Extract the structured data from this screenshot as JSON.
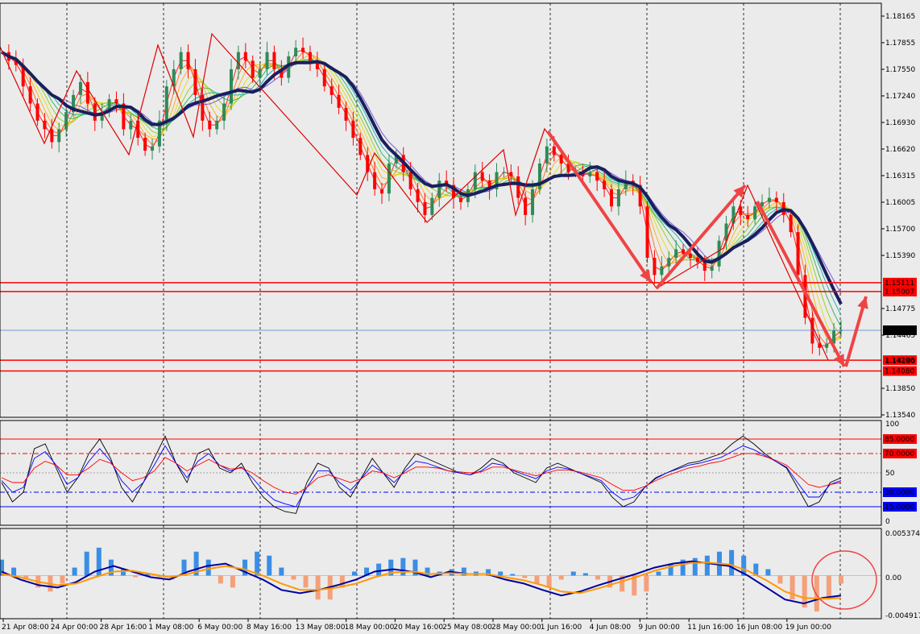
{
  "chart_data": [
    {
      "panel": "price",
      "type": "candlestick",
      "y_ticks": [
        "1.18165",
        "1.17855",
        "1.17550",
        "1.17240",
        "1.16930",
        "1.16620",
        "1.16315",
        "1.16005",
        "1.15700",
        "1.15390"
      ],
      "y_ticks_lower": [
        "1.14775",
        "1.14465",
        "1.13850",
        "1.13540"
      ],
      "ylim": [
        1.1354,
        1.1837
      ],
      "price_levels": [
        {
          "label": "1.15111",
          "value": 1.15111,
          "color": "#ff0000"
        },
        {
          "label": "1.15007",
          "value": 1.15007,
          "color": "#ff0000"
        },
        {
          "label": "1.14206",
          "value": 1.14206,
          "color": "#ff0000"
        },
        {
          "label": "1.14080",
          "value": 1.1408,
          "color": "#ff0000"
        }
      ],
      "current_price": {
        "label": "1.14555",
        "value": 1.14555,
        "color": "#4a7fd0"
      },
      "hidden_label": "1.14180",
      "close_series": [
        1.178,
        1.177,
        1.1765,
        1.174,
        1.172,
        1.17,
        1.169,
        1.1675,
        1.169,
        1.171,
        1.173,
        1.1745,
        1.172,
        1.17,
        1.171,
        1.1725,
        1.172,
        1.169,
        1.17,
        1.168,
        1.1665,
        1.167,
        1.17,
        1.174,
        1.176,
        1.178,
        1.176,
        1.173,
        1.17,
        1.169,
        1.17,
        1.172,
        1.176,
        1.178,
        1.177,
        1.175,
        1.176,
        1.178,
        1.176,
        1.175,
        1.1775,
        1.1785,
        1.178,
        1.177,
        1.176,
        1.174,
        1.173,
        1.1715,
        1.17,
        1.168,
        1.166,
        1.164,
        1.162,
        1.1615,
        1.165,
        1.166,
        1.164,
        1.162,
        1.1605,
        1.159,
        1.161,
        1.163,
        1.1625,
        1.161,
        1.1605,
        1.162,
        1.164,
        1.163,
        1.162,
        1.164,
        1.164,
        1.1635,
        1.161,
        1.159,
        1.162,
        1.165,
        1.167,
        1.166,
        1.165,
        1.164,
        1.164,
        1.1635,
        1.164,
        1.163,
        1.162,
        1.16,
        1.162,
        1.163,
        1.1625,
        1.16,
        1.154,
        1.152,
        1.153,
        1.154,
        1.155,
        1.1545,
        1.154,
        1.1535,
        1.1525,
        1.153,
        1.156,
        1.158,
        1.16,
        1.159,
        1.1585,
        1.16,
        1.1605,
        1.161,
        1.1605,
        1.159,
        1.157,
        1.152,
        1.147,
        1.144,
        1.1435,
        1.144,
        1.1455,
        1.14555
      ],
      "annotations": [
        "zigzag-peaks-troughs",
        "trend-arrows"
      ]
    },
    {
      "panel": "oscillator",
      "type": "line",
      "y_ticks": [
        "100",
        "50",
        "0"
      ],
      "levels": [
        {
          "label": "85.0000",
          "value": 85,
          "color": "#ff0000"
        },
        {
          "label": "70.0000",
          "value": 70,
          "color": "#ff0000"
        },
        {
          "label": "30.0000",
          "value": 30,
          "color": "#0000ff"
        },
        {
          "label": "15.0000",
          "value": 15,
          "color": "#0000ff"
        }
      ],
      "series": [
        {
          "color": "#000000",
          "values": [
            40,
            20,
            30,
            75,
            80,
            55,
            30,
            45,
            70,
            85,
            65,
            35,
            20,
            40,
            65,
            88,
            60,
            40,
            70,
            75,
            55,
            50,
            60,
            40,
            25,
            15,
            10,
            8,
            40,
            60,
            55,
            35,
            25,
            45,
            65,
            50,
            35,
            55,
            70,
            65,
            60,
            55,
            50,
            48,
            55,
            65,
            60,
            50,
            45,
            40,
            55,
            60,
            55,
            50,
            45,
            40,
            25,
            15,
            20,
            35,
            45,
            50,
            55,
            60,
            62,
            66,
            70,
            80,
            88,
            80,
            70,
            62,
            55,
            35,
            15,
            20,
            40,
            45
          ]
        },
        {
          "color": "#0000ff",
          "values": [
            42,
            30,
            35,
            65,
            72,
            58,
            38,
            45,
            62,
            75,
            62,
            42,
            30,
            40,
            58,
            78,
            60,
            45,
            62,
            70,
            58,
            52,
            56,
            45,
            32,
            22,
            18,
            15,
            35,
            52,
            52,
            40,
            32,
            44,
            58,
            50,
            40,
            52,
            62,
            60,
            56,
            52,
            50,
            48,
            52,
            60,
            58,
            52,
            48,
            44,
            52,
            56,
            54,
            50,
            46,
            42,
            30,
            22,
            25,
            35,
            44,
            50,
            54,
            58,
            60,
            63,
            66,
            72,
            78,
            74,
            68,
            62,
            56,
            40,
            25,
            25,
            38,
            42
          ]
        },
        {
          "color": "#ff0000",
          "values": [
            45,
            40,
            40,
            55,
            62,
            58,
            48,
            48,
            55,
            64,
            60,
            50,
            42,
            45,
            52,
            66,
            60,
            52,
            58,
            64,
            58,
            54,
            55,
            50,
            42,
            35,
            30,
            28,
            35,
            45,
            48,
            44,
            40,
            44,
            52,
            50,
            45,
            50,
            56,
            56,
            55,
            52,
            51,
            50,
            51,
            56,
            56,
            53,
            50,
            47,
            50,
            53,
            53,
            51,
            48,
            45,
            38,
            32,
            32,
            36,
            42,
            47,
            51,
            55,
            57,
            60,
            62,
            66,
            70,
            70,
            67,
            63,
            58,
            48,
            38,
            35,
            38,
            40
          ]
        }
      ]
    },
    {
      "panel": "macd",
      "type": "histogram+line",
      "y_ticks": [
        "0.0053741",
        "0.00",
        "-0.004917"
      ],
      "ylim": [
        -0.0049,
        0.0054
      ],
      "histogram": [
        0.002,
        0.001,
        -0.0005,
        -0.0015,
        -0.002,
        -0.001,
        0.001,
        0.003,
        0.0035,
        0.002,
        0.0008,
        -0.0002,
        0.0002,
        -0.0002,
        -0.0005,
        0.002,
        0.003,
        0.002,
        -0.001,
        -0.0015,
        0.002,
        0.003,
        0.0025,
        0.001,
        -0.0005,
        -0.0015,
        -0.003,
        -0.003,
        -0.0015,
        0.0005,
        0.001,
        0.0015,
        0.002,
        0.0022,
        0.002,
        0.001,
        0.0005,
        0.0008,
        0.001,
        0.0005,
        0.0008,
        0.0005,
        0.0002,
        -0.0003,
        -0.001,
        -0.0015,
        -0.0005,
        0.0005,
        0.0003,
        -0.0005,
        -0.0015,
        -0.002,
        -0.0025,
        -0.002,
        0.0005,
        0.0015,
        0.002,
        0.0022,
        0.0025,
        0.003,
        0.0032,
        0.0025,
        0.0015,
        0.0008,
        -0.001,
        -0.003,
        -0.004,
        -0.0045,
        -0.003,
        -0.001
      ],
      "lines": [
        {
          "color": "#0000a0",
          "values": [
            0.0005,
            -0.0005,
            -0.0012,
            -0.0015,
            -0.0008,
            0.0005,
            0.0012,
            0.0005,
            -0.0002,
            -0.0005,
            0.0005,
            0.0012,
            0.0015,
            0.0005,
            -0.0005,
            -0.0018,
            -0.0022,
            -0.0018,
            -0.0012,
            -0.0005,
            0.0005,
            0.0008,
            0.0005,
            -0.0002,
            0.0005,
            0.0002,
            0.0002,
            -0.0005,
            -0.001,
            -0.0018,
            -0.0025,
            -0.002,
            -0.0012,
            -0.0005,
            0.0002,
            0.001,
            0.0015,
            0.0018,
            0.0015,
            0.0012,
            0.0,
            -0.0015,
            -0.003,
            -0.0035,
            -0.0028,
            -0.0025
          ]
        },
        {
          "color": "#ff9900",
          "values": [
            0.0002,
            -0.0002,
            -0.0008,
            -0.0012,
            -0.001,
            -0.0002,
            0.0005,
            0.0006,
            0.0002,
            -0.0002,
            0.0002,
            0.0008,
            0.0012,
            0.0008,
            0.0,
            -0.001,
            -0.0018,
            -0.0018,
            -0.0015,
            -0.001,
            -0.0002,
            0.0004,
            0.0005,
            0.0002,
            0.0003,
            0.0002,
            0.0002,
            -0.0002,
            -0.0006,
            -0.0012,
            -0.002,
            -0.0022,
            -0.0016,
            -0.0009,
            -0.0002,
            0.0006,
            0.0012,
            0.0016,
            0.0016,
            0.0014,
            0.0006,
            -0.0006,
            -0.002,
            -0.0028,
            -0.0029,
            -0.0028
          ]
        }
      ]
    }
  ],
  "x_labels": [
    "21 Apr 08:00",
    "24 Apr 00:00",
    "28 Apr 16:00",
    "1 May 08:00",
    "6 May 00:00",
    "8 May 16:00",
    "13 May 08:00",
    "18 May 00:00",
    "20 May 16:00",
    "25 May 08:00",
    "28 May 00:00",
    "1 Jun 16:00",
    "4 Jun 08:00",
    "9 Jun 00:00",
    "11 Jun 16:00",
    "16 Jun 08:00",
    "19 Jun 00:00"
  ],
  "colors": {
    "background": "#ebebeb",
    "bull": "#2e8b57",
    "bear": "#ff0000",
    "ma": "#1a1f5e",
    "annotation": "#ef4444"
  }
}
